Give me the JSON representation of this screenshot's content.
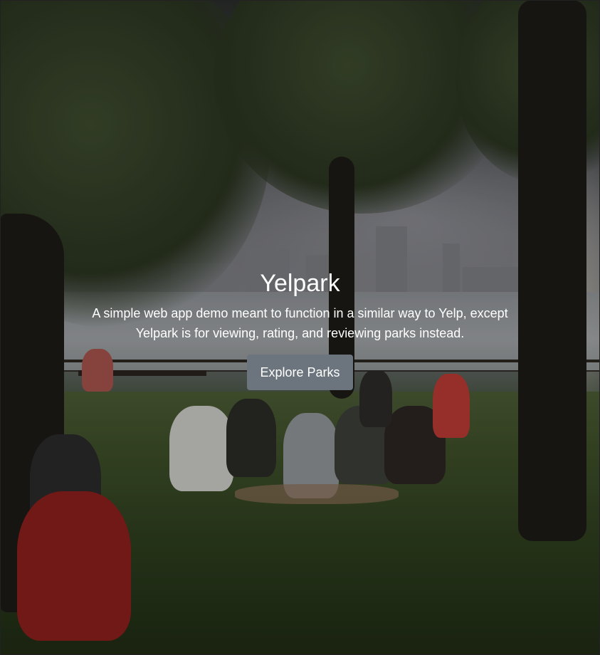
{
  "hero": {
    "title": "Yelpark",
    "lead": "A simple web app demo meant to function in a similar way to Yelp, except Yelpark is for viewing, rating, and reviewing parks instead.",
    "cta_label": "Explore Parks"
  },
  "colors": {
    "button_bg": "#6c757d",
    "text": "#ffffff"
  }
}
